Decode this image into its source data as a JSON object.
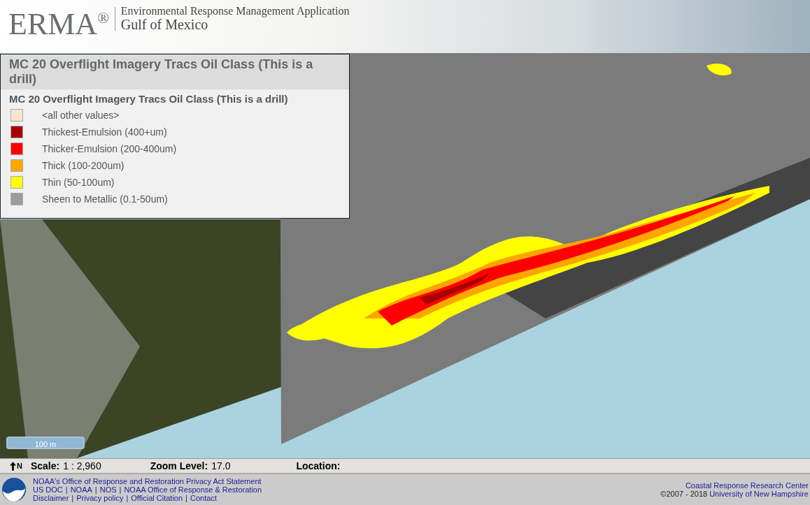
{
  "header": {
    "logo": "ERMA",
    "registered": "®",
    "subtitle": "Environmental Response Management Application",
    "region": "Gulf of Mexico"
  },
  "legend": {
    "panel_title": "MC 20 Overflight Imagery Tracs Oil Class (This is a drill)",
    "layer_title": "MC 20 Overflight Imagery Tracs Oil Class (This is a drill)",
    "items": [
      {
        "label": "<all other values>",
        "color": "#fde3cb"
      },
      {
        "label": "Thickest-Emulsion (400+um)",
        "color": "#a80000"
      },
      {
        "label": "Thicker-Emulsion (200-400um)",
        "color": "#ff0000"
      },
      {
        "label": "Thick (100-200um)",
        "color": "#ffa500"
      },
      {
        "label": "Thin (50-100um)",
        "color": "#ffff00"
      },
      {
        "label": "Sheen to Metallic (0.1-50um)",
        "color": "#9c9c9c"
      }
    ]
  },
  "scale_bar": "100 m",
  "status_bar": {
    "north_label": "N",
    "scale_label": "Scale:",
    "scale_value": "1 : 2,960",
    "zoom_label": "Zoom Level:",
    "zoom_value": "17.0",
    "location_label": "Location:"
  },
  "footer": {
    "left_lines": [
      [
        {
          "kind": "link",
          "text": "NOAA's Office of Response and Restoration Privacy Act Statement"
        }
      ],
      [
        {
          "kind": "link",
          "text": "US DOC"
        },
        {
          "kind": "separator",
          "text": "|"
        },
        {
          "kind": "link",
          "text": "NOAA"
        },
        {
          "kind": "separator",
          "text": "|"
        },
        {
          "kind": "link",
          "text": "NOS"
        },
        {
          "kind": "separator",
          "text": "|"
        },
        {
          "kind": "link",
          "text": "NOAA Office of Response & Restoration"
        }
      ],
      [
        {
          "kind": "link",
          "text": "Disclaimer"
        },
        {
          "kind": "separator",
          "text": "|"
        },
        {
          "kind": "link",
          "text": "Privacy policy"
        },
        {
          "kind": "separator",
          "text": "|"
        },
        {
          "kind": "link",
          "text": "Official Citation"
        },
        {
          "kind": "separator",
          "text": "|"
        },
        {
          "kind": "link",
          "text": "Contact"
        }
      ]
    ],
    "right_link": "Coastal Response Research Center",
    "copyright": "©2007 - 2018",
    "right_link2": "University of New Hampshire"
  }
}
